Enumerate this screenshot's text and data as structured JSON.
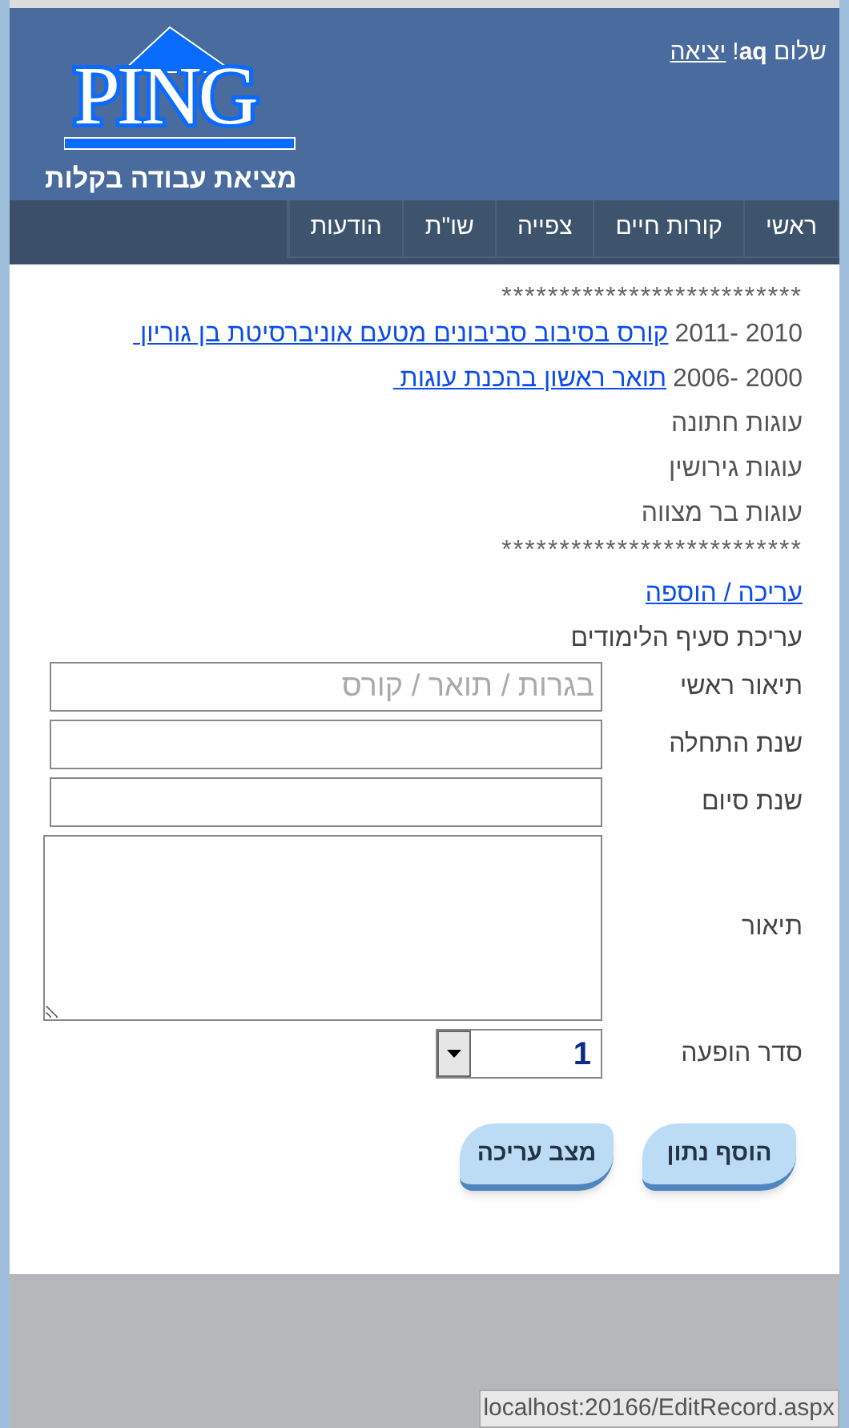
{
  "header": {
    "greeting": "שלום **aq**!",
    "logout_link": "יציאה",
    "logo": "PING",
    "tagline": "מציאת עבודה בקלות"
  },
  "nav": [
    {
      "label": "ראשי"
    },
    {
      "label": "קורות חיים"
    },
    {
      "label": "צפייה"
    },
    {
      "label": "שו\"ת"
    },
    {
      "label": "הודעות"
    }
  ],
  "records": [
    {
      "kind": "separator",
      "text": "**************************"
    },
    {
      "kind": "entry",
      "years": "2010 -2011",
      "link": "קורס בסיבוב סביבונים מטעם אוניברסיטת בן גוריון "
    },
    {
      "kind": "entry",
      "years": "2000 -2006",
      "link": "תואר ראשון בהכנת עוגות "
    },
    {
      "kind": "text",
      "text": "עוגות חתונה"
    },
    {
      "kind": "text",
      "text": "עוגות גירושין"
    },
    {
      "kind": "text",
      "text": "עוגות בר מצווה"
    },
    {
      "kind": "separator",
      "text": "**************************"
    }
  ],
  "edit_link": "עריכה / הוספה",
  "form_title": "עריכת סעיף הלימודים",
  "form": [
    {
      "kind": "input",
      "label": "תיאור ראשי",
      "placeholder": "בגרות / תואר / קורס"
    },
    {
      "kind": "input",
      "label": "שנת התחלה"
    },
    {
      "kind": "input",
      "label": "שנת סיום"
    },
    {
      "kind": "textarea",
      "label": "תיאור"
    },
    {
      "kind": "select",
      "label": "סדר הופעה",
      "value": "1"
    }
  ],
  "buttons": [
    "הוסף נתון",
    "מצב עריכה"
  ],
  "status_url": "localhost:20166/EditRecord.aspx"
}
